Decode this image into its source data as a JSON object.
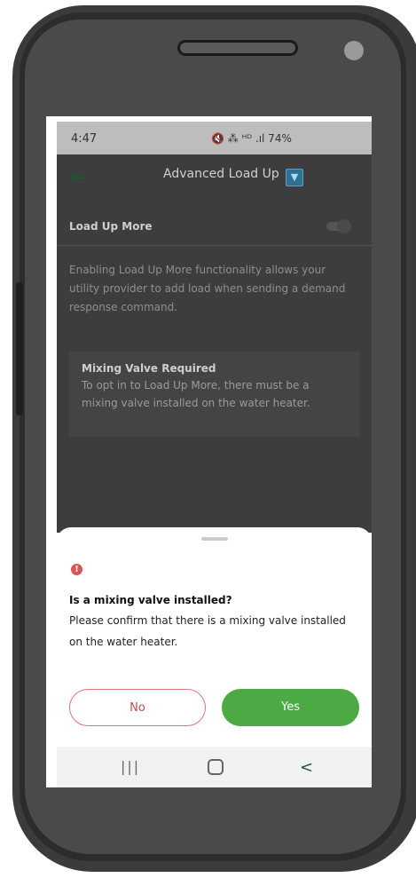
{
  "status_bar": {
    "time": "4:47",
    "indicators": "🔇 ⁂ ᴴᴰ .ıl 74%",
    "battery_level": "74%"
  },
  "app_bar": {
    "back_icon": "arrow-left-icon",
    "title": "Advanced Load Up",
    "logo_icon": "app-logo-icon"
  },
  "settings": {
    "load_up_more_label": "Load Up More",
    "toggle_state": "off",
    "description": "Enabling Load Up More functionality allows your utility provider to add load when sending a demand response command."
  },
  "notice": {
    "title": "Mixing Valve Required",
    "body": "To opt in to Load Up More, there must be a mixing valve installed on the water heater."
  },
  "sheet": {
    "alert_icon": "exclamation-icon",
    "title": "Is a mixing valve installed?",
    "body": "Please confirm that there is a mixing valve installed on the water heater.",
    "no_label": "No",
    "yes_label": "Yes"
  },
  "nav_bar": {
    "recent_label": "|||",
    "back_label": "<"
  },
  "colors": {
    "accent_green": "#4caa45",
    "alert_red": "#e05252",
    "no_button_border": "#d9777b"
  }
}
